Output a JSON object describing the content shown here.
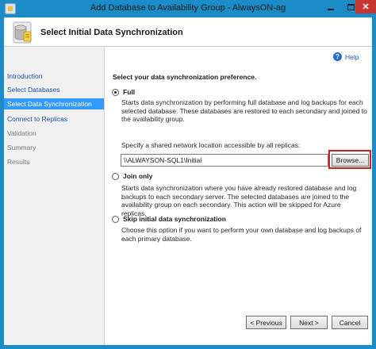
{
  "window": {
    "title": "Add Database to Availability Group - AlwaysON-ag",
    "min_icon": "minimize-icon",
    "max_icon": "maximize-icon",
    "close_label": "✕"
  },
  "header": {
    "title": "Select Initial Data Synchronization",
    "icon": "database-icon"
  },
  "sidebar": {
    "items": [
      {
        "label": "Introduction",
        "state": "link"
      },
      {
        "label": "Select Databases",
        "state": "link"
      },
      {
        "label": "Select Data Synchronization",
        "state": "active"
      },
      {
        "label": "Connect to Replicas",
        "state": "link"
      },
      {
        "label": "Validation",
        "state": "dim"
      },
      {
        "label": "Summary",
        "state": "dim"
      },
      {
        "label": "Results",
        "state": "dim"
      }
    ]
  },
  "help": {
    "label": "Help"
  },
  "main": {
    "prompt": "Select your data synchronization preference.",
    "options": [
      {
        "label": "Full",
        "checked": true,
        "description": "Starts data synchronization by performing full database and log backups for each selected database. These databases are restored to each secondary and joined to the availability group."
      },
      {
        "label": "Join only",
        "checked": false,
        "description": "Starts data synchronization where you have already restored database and log backups to each secondary server. The selected databases are joined to the availability group on each secondary. This action will be skipped for Azure replicas."
      },
      {
        "label": "Skip initial data synchronization",
        "checked": false,
        "description": "Choose this option if you want to perform your own database and log backups of each primary database."
      }
    ],
    "share_label": "Specify a shared network location accessible by all replicas:",
    "share_value": "\\\\ALWAYSON-SQL1\\Initial",
    "browse_label": "Browse..."
  },
  "footer": {
    "previous_label": "< Previous",
    "next_label": "Next >",
    "cancel_label": "Cancel"
  },
  "colors": {
    "titlebar": "#1c8cc8",
    "close": "#c7372f",
    "active_item": "#3399ff",
    "link": "#1f4fa8",
    "highlight": "#d21e1e"
  }
}
